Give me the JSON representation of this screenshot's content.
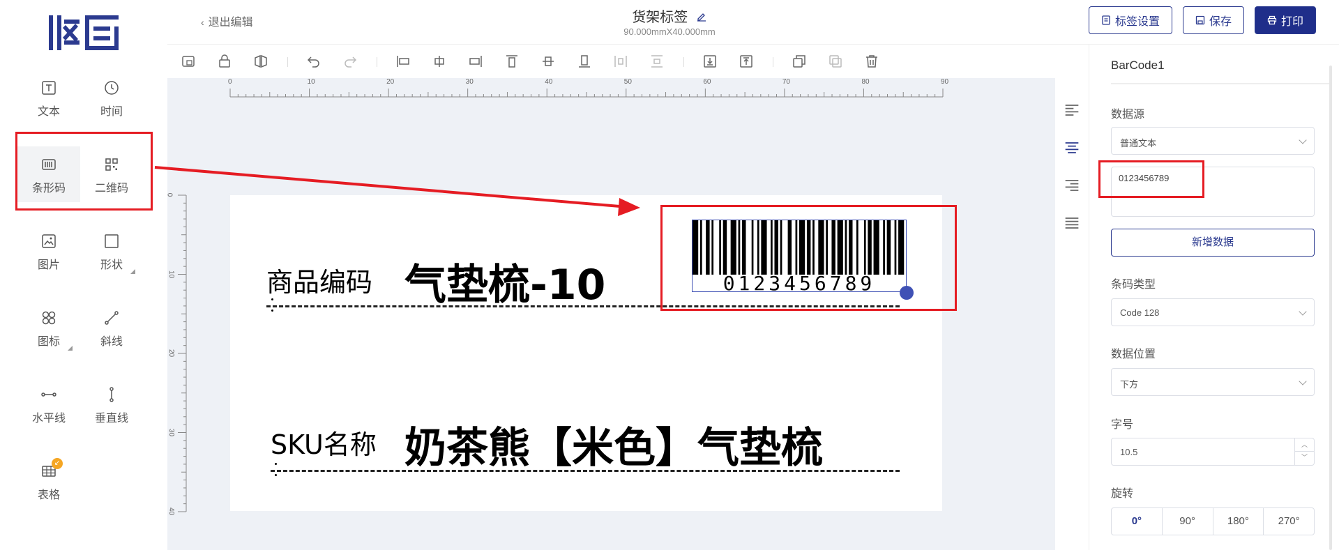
{
  "app": {
    "logo_text": "拟码",
    "back_label": "退出编辑",
    "title": "货架标签",
    "subtitle": "90.000mmX40.000mm",
    "buttons": {
      "label_settings": "标签设置",
      "save": "保存",
      "print": "打印"
    }
  },
  "sidebar": {
    "tools": [
      {
        "label": "文本",
        "icon": "text-icon"
      },
      {
        "label": "时间",
        "icon": "clock-icon"
      },
      {
        "label": "条形码",
        "icon": "barcode-icon",
        "active": true
      },
      {
        "label": "二维码",
        "icon": "qrcode-icon"
      },
      {
        "label": "图片",
        "icon": "image-icon"
      },
      {
        "label": "形状",
        "icon": "shape-icon"
      },
      {
        "label": "图标",
        "icon": "icons-icon"
      },
      {
        "label": "斜线",
        "icon": "diagonal-line-icon"
      },
      {
        "label": "水平线",
        "icon": "horizontal-line-icon"
      },
      {
        "label": "垂直线",
        "icon": "vertical-line-icon"
      },
      {
        "label": "表格",
        "icon": "table-icon"
      }
    ]
  },
  "ruler": {
    "top_ticks": [
      "0",
      "10",
      "20",
      "30",
      "40",
      "50",
      "60",
      "70",
      "80",
      "90"
    ],
    "left_ticks": [
      "0",
      "10",
      "20",
      "30",
      "40"
    ]
  },
  "label_content": {
    "row1_caption": "商品编码",
    "row1_value": "气垫梳-10",
    "row2_caption": "SKU名称",
    "row2_value": "奶茶熊【米色】气垫梳",
    "barcode_text": "0123456789"
  },
  "panel": {
    "element_name": "BarCode1",
    "data_source_label": "数据源",
    "data_source_value": "普通文本",
    "data_value": "0123456789",
    "add_data_button": "新增数据",
    "barcode_type_label": "条码类型",
    "barcode_type_value": "Code 128",
    "data_position_label": "数据位置",
    "data_position_value": "下方",
    "font_size_label": "字号",
    "font_size_value": "10.5",
    "rotate_label": "旋转",
    "rotate_options": [
      "0°",
      "90°",
      "180°",
      "270°"
    ],
    "rotate_selected": "0°"
  }
}
